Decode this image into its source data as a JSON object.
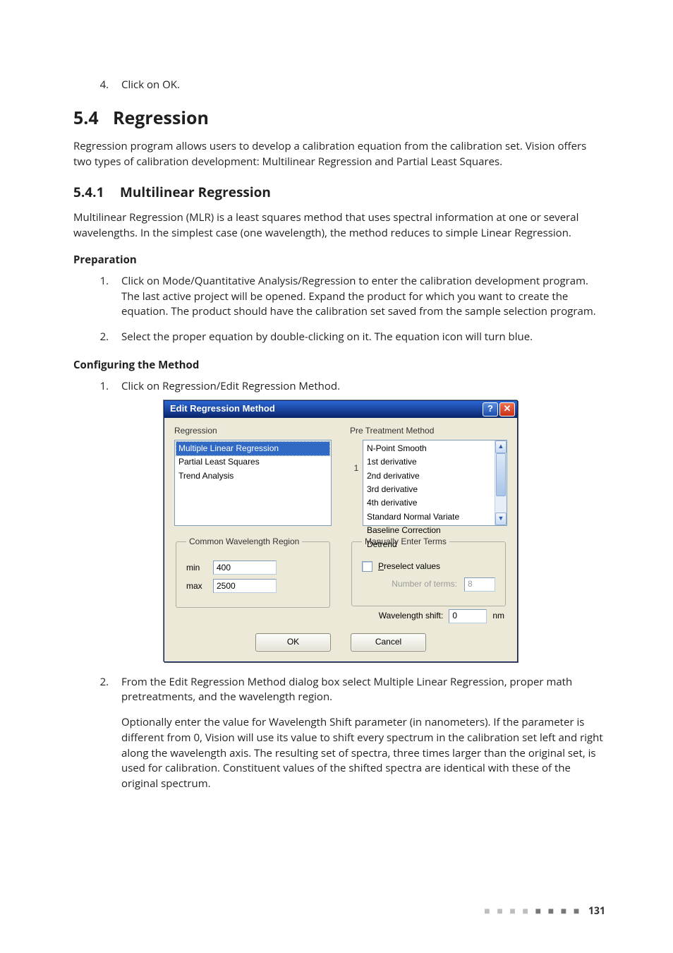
{
  "pre_list": {
    "start": 4,
    "items": [
      "Click on OK."
    ]
  },
  "section": {
    "num": "5.4",
    "title": "Regression"
  },
  "intro": "Regression program allows users to develop a calibration equation from the calibration set. Vision offers two types of calibration development: Multilinear Regression and Partial Least Squares.",
  "subsection": {
    "num": "5.4.1",
    "title": "Multilinear Regression"
  },
  "mlr_para": "Multilinear Regression (MLR) is a least squares method that uses spectral information at one or several wavelengths. In the simplest case (one wavelength), the method reduces to simple Linear Regression.",
  "prep": {
    "heading": "Preparation",
    "items": [
      "Click on Mode/Quantitative Analysis/Regression to enter the calibration development program. The last active project will be opened. Expand the product for which you want to create the equation. The product should have the calibration set saved from the sample selection program.",
      "Select the proper equation by double-clicking on it. The equation icon will turn blue."
    ]
  },
  "cfg": {
    "heading": "Configuring the Method",
    "items": [
      "Click on Regression/Edit Regression Method.",
      "From the Edit Regression Method dialog box select Multiple Linear Regression, proper math pretreatments, and the wavelength region."
    ],
    "follow2": "Optionally enter the value for Wavelength Shift parameter (in nanometers). If the parameter is different from 0, Vision will use its value to shift every spectrum in the calibration set left and right along the wavelength axis. The resulting set of spectra, three times larger than the original set, is used for calibration. Constituent values of the shifted spectra are identical with these of the original spectrum."
  },
  "dialog": {
    "title": "Edit Regression Method",
    "regression_label": "Regression",
    "ptm_label": "Pre Treatment Method",
    "regression_items": [
      "Multiple Linear Regression",
      "Partial Least Squares",
      "Trend Analysis"
    ],
    "ptm_index": "1",
    "ptm_items": [
      "N-Point Smooth",
      "1st derivative",
      "2nd derivative",
      "3rd derivative",
      "4th derivative",
      "Standard Normal Variate",
      "Baseline Correction",
      "Detrend"
    ],
    "cwr": {
      "legend": "Common Wavelength Region",
      "min_label": "min",
      "max_label": "max",
      "min": "400",
      "max": "2500"
    },
    "met": {
      "legend": "Manually Enter Terms",
      "preselect_prefix": "P",
      "preselect_rest": "reselect values",
      "nterms_label": "Number of terms:",
      "nterms_value": "8"
    },
    "wshift": {
      "label": "Wavelength shift:",
      "value": "0",
      "unit": "nm"
    },
    "ok": "OK",
    "cancel": "Cancel"
  },
  "page_number": "131"
}
